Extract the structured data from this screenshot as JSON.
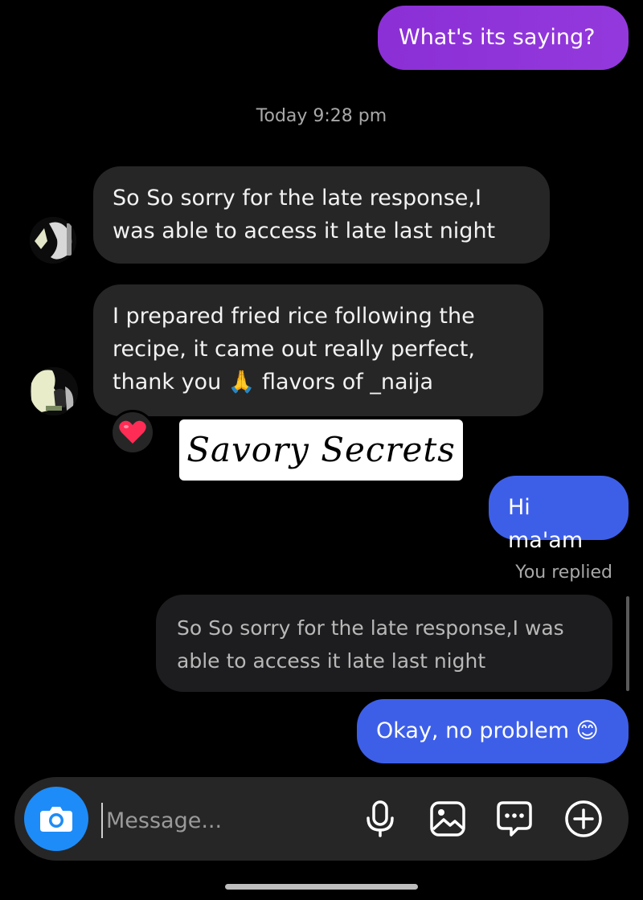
{
  "messages": {
    "m1": "What's its saying?",
    "timestamp": "Today 9:28 pm",
    "m2": "So So sorry for the late response,I was able to access it late last night",
    "m3_before_emoji": "I prepared fried rice following the recipe, it came out really perfect, thank you ",
    "m3_emoji": "🙏",
    "m3_after_emoji": " flavors of _naija",
    "reaction_emoji": "❤️",
    "sticker_text": "Savory Secrets",
    "m4": "Hi ma'am",
    "you_replied": "You replied",
    "quoted": "So So sorry for the late response,I was able to access it late last night",
    "m5_text": "Okay, no problem ",
    "m5_emoji": "😊"
  },
  "composer": {
    "placeholder": "Message..."
  },
  "icons": {
    "camera": "camera-icon",
    "mic": "microphone-icon",
    "gallery": "gallery-icon",
    "sticker": "chat-sticker-icon",
    "add": "plus-circle-icon"
  },
  "colors": {
    "purple_bubble": "#8b2fd6",
    "blue_bubble": "#3d5fe8",
    "incoming_bubble": "#262626",
    "camera_button": "#1d8cf8"
  }
}
